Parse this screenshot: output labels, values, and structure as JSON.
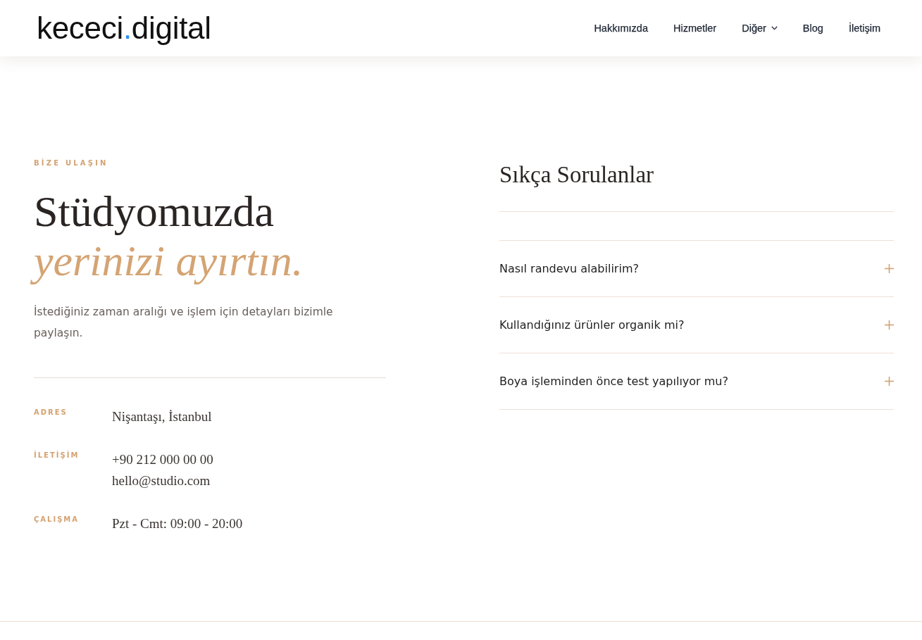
{
  "header": {
    "logo": {
      "name": "kececi",
      "dot": ".",
      "domain": "digital"
    },
    "nav": [
      {
        "label": "Hakkımızda",
        "has_dropdown": false
      },
      {
        "label": "Hizmetler",
        "has_dropdown": false
      },
      {
        "label": "Diğer",
        "has_dropdown": true
      },
      {
        "label": "Blog",
        "has_dropdown": false
      },
      {
        "label": "İletişim",
        "has_dropdown": false
      }
    ]
  },
  "contact": {
    "eyebrow": "BİZE ULAŞIN",
    "heading": "Stüdyomuzda",
    "heading_accent": "yerinizi ayırtın.",
    "intro": "İstediğiniz zaman aralığı ve işlem için detayları bizimle paylaşın.",
    "details": [
      {
        "label": "ADRES",
        "values": [
          "Nişantaşı, İstanbul"
        ]
      },
      {
        "label": "İLETİŞİM",
        "values": [
          "+90 212 000 00 00",
          "hello@studio.com"
        ]
      },
      {
        "label": "ÇALIŞMA",
        "values": [
          "Pzt - Cmt: 09:00 - 20:00"
        ]
      }
    ]
  },
  "faq": {
    "title": "Sıkça Sorulanlar",
    "items": [
      {
        "question": "Nasıl randevu alabilirim?",
        "expanded": false
      },
      {
        "question": "Kullandığınız ürünler organik mi?",
        "expanded": false
      },
      {
        "question": "Boya işleminden önce test yapılıyor mu?",
        "expanded": false
      }
    ]
  }
}
